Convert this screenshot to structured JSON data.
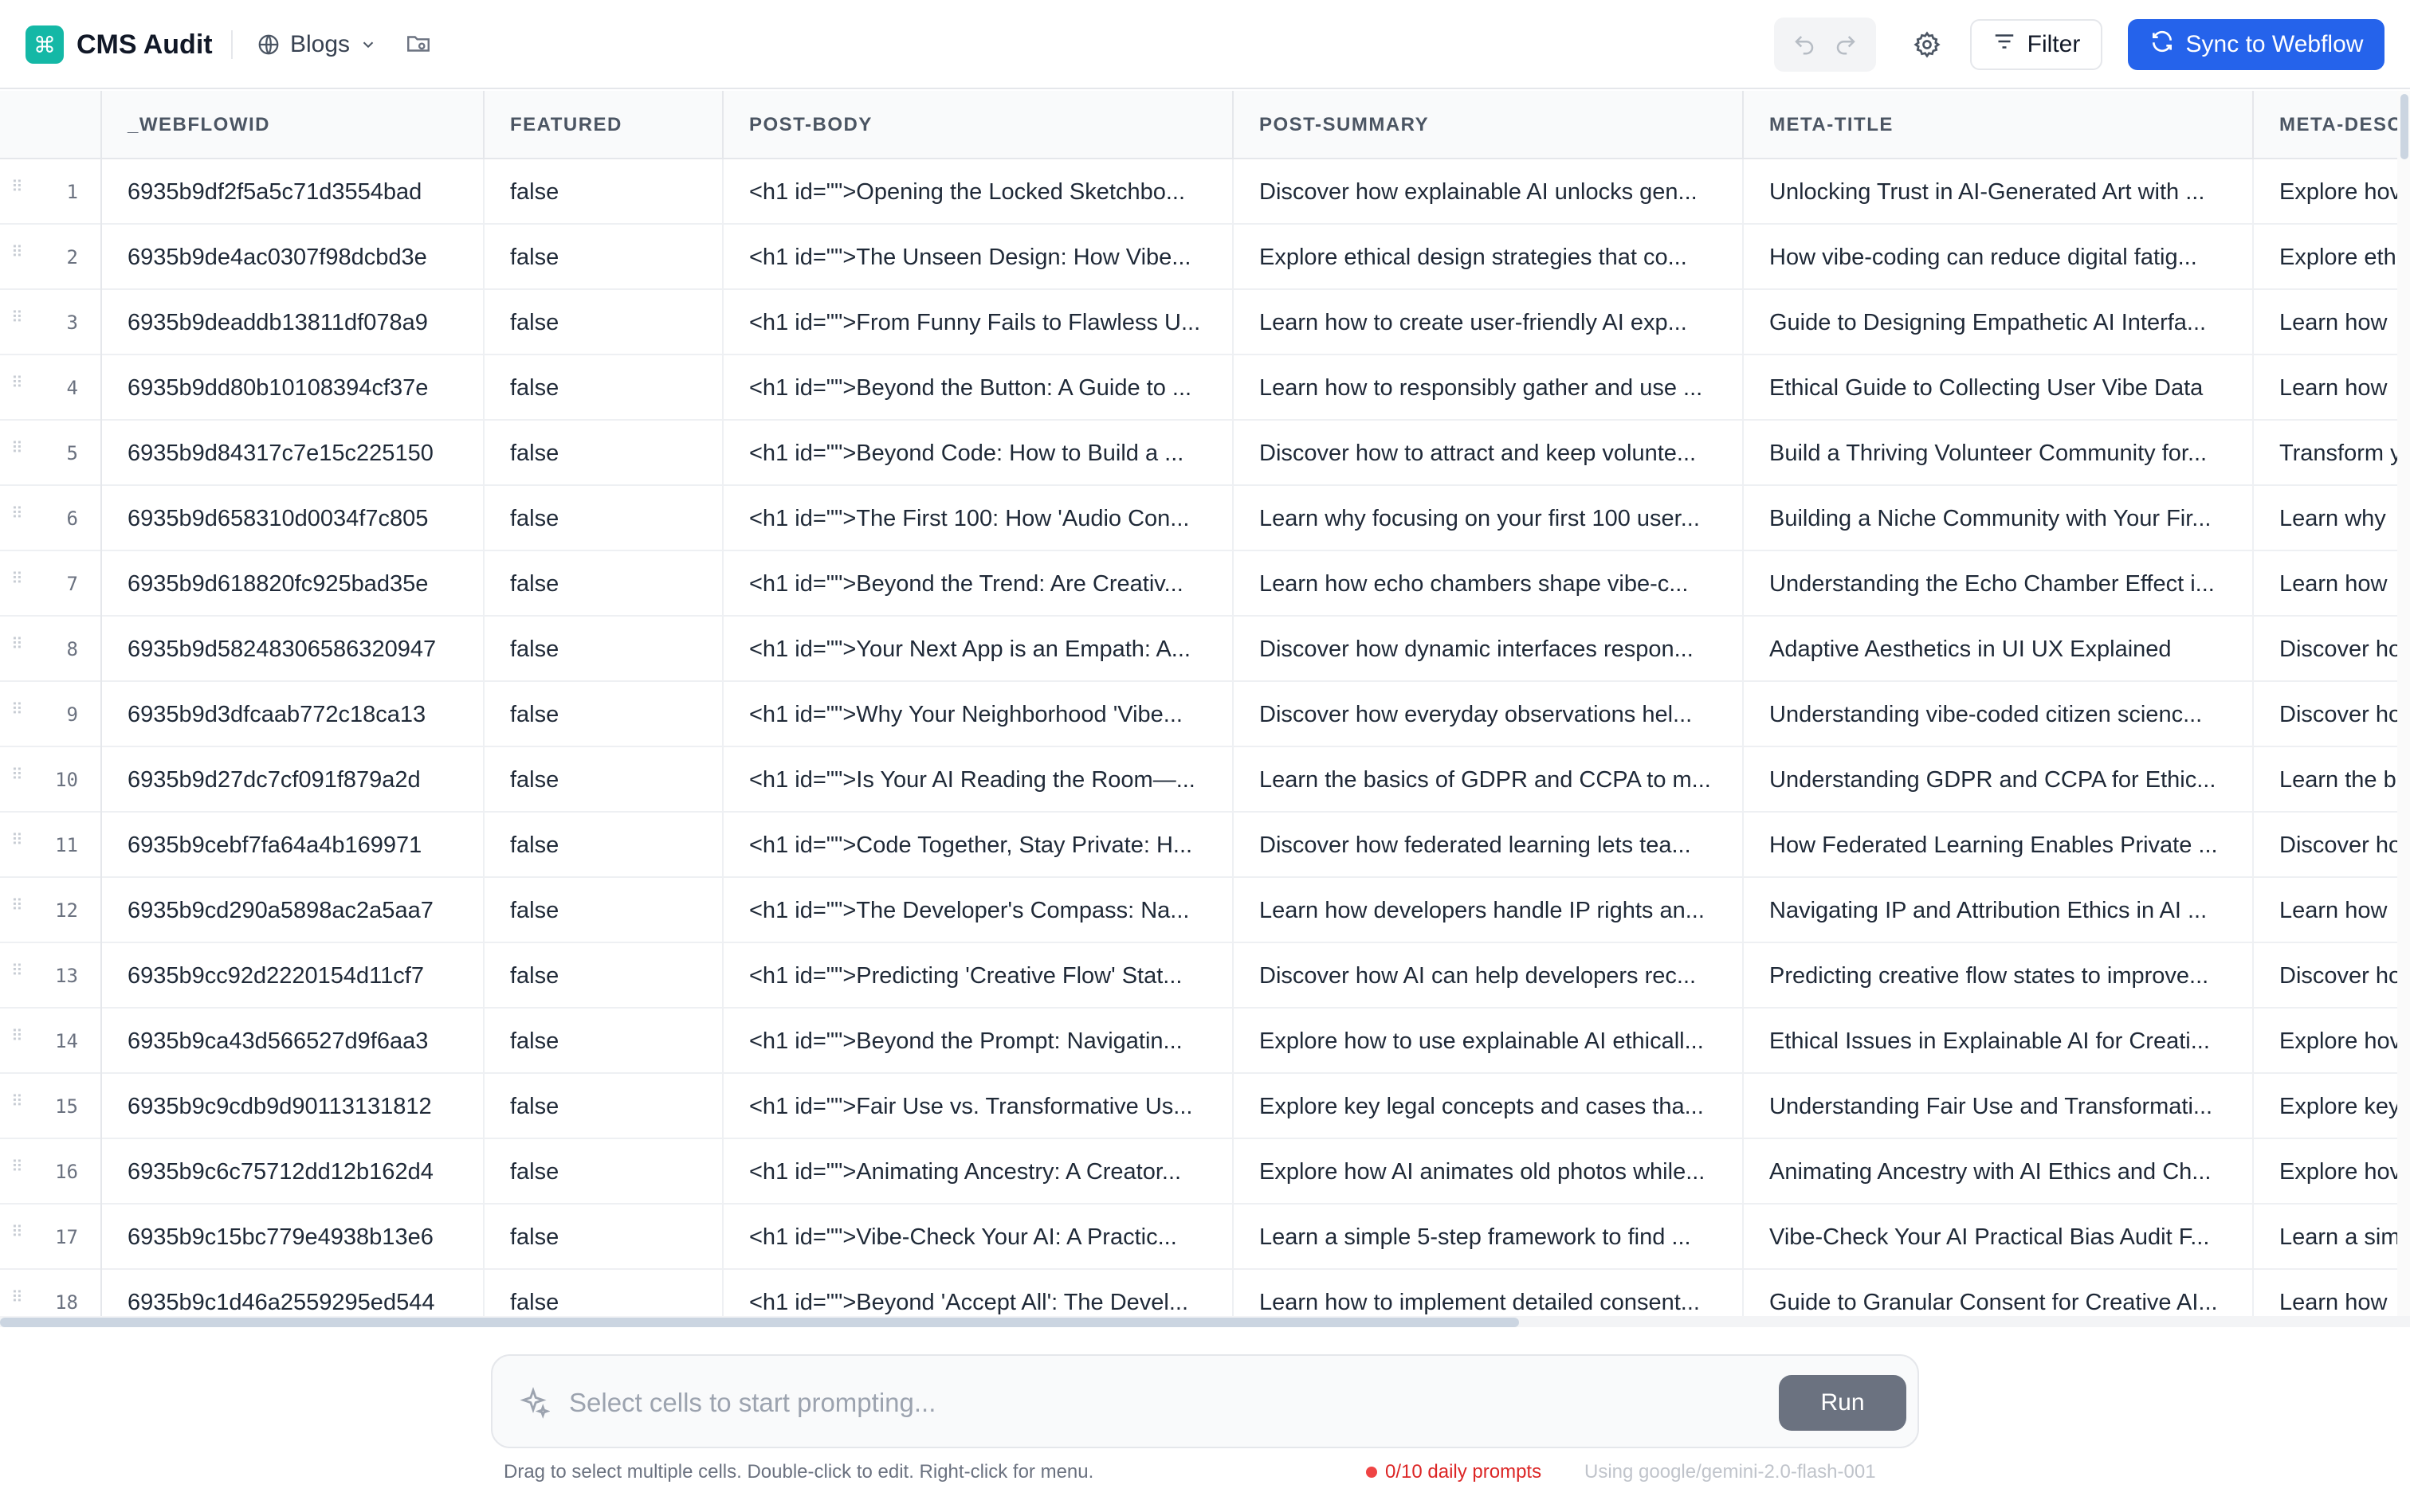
{
  "header": {
    "logo_glyph": "⌘",
    "app_title": "CMS Audit",
    "collection": "Blogs",
    "filter_label": "Filter",
    "sync_label": "Sync to Webflow"
  },
  "colors": {
    "brand": "#14b8a6",
    "primary": "#2563eb",
    "quota": "#dc2626"
  },
  "table": {
    "columns": [
      "_WEBFLOWID",
      "FEATURED",
      "POST-BODY",
      "POST-SUMMARY",
      "META-TITLE",
      "META-DESC"
    ],
    "rows": [
      {
        "n": "1",
        "id": "6935b9df2f5a5c71d3554bad",
        "featured": "false",
        "body": "<h1 id=\"\">Opening the Locked Sketchbo...",
        "summary": "Discover how explainable AI unlocks gen...",
        "title": "Unlocking Trust in AI-Generated Art with ...",
        "desc": "Explore hov"
      },
      {
        "n": "2",
        "id": "6935b9de4ac0307f98dcbd3e",
        "featured": "false",
        "body": "<h1 id=\"\">The Unseen Design: How Vibe...",
        "summary": "Explore ethical design strategies that co...",
        "title": "How vibe-coding can reduce digital fatig...",
        "desc": "Explore eth"
      },
      {
        "n": "3",
        "id": "6935b9deaddb13811df078a9",
        "featured": "false",
        "body": "<h1 id=\"\">From Funny Fails to Flawless U...",
        "summary": "Learn how to create user-friendly AI exp...",
        "title": "Guide to Designing Empathetic AI Interfa...",
        "desc": "Learn how"
      },
      {
        "n": "4",
        "id": "6935b9dd80b10108394cf37e",
        "featured": "false",
        "body": "<h1 id=\"\">Beyond the Button: A Guide to ...",
        "summary": "Learn how to responsibly gather and use ...",
        "title": "Ethical Guide to Collecting User Vibe Data",
        "desc": "Learn how"
      },
      {
        "n": "5",
        "id": "6935b9d84317c7e15c225150",
        "featured": "false",
        "body": "<h1 id=\"\">Beyond Code: How to Build a ...",
        "summary": "Discover how to attract and keep volunte...",
        "title": "Build a Thriving Volunteer Community for...",
        "desc": "Transform y"
      },
      {
        "n": "6",
        "id": "6935b9d658310d0034f7c805",
        "featured": "false",
        "body": "<h1 id=\"\">The First 100: How 'Audio Con...",
        "summary": "Learn why focusing on your first 100 user...",
        "title": "Building a Niche Community with Your Fir...",
        "desc": "Learn why"
      },
      {
        "n": "7",
        "id": "6935b9d618820fc925bad35e",
        "featured": "false",
        "body": "<h1 id=\"\">Beyond the Trend: Are Creativ...",
        "summary": "Learn how echo chambers shape vibe-c...",
        "title": "Understanding the Echo Chamber Effect i...",
        "desc": "Learn how"
      },
      {
        "n": "8",
        "id": "6935b9d58248306586320947",
        "featured": "false",
        "body": "<h1 id=\"\">Your Next App is an Empath: A...",
        "summary": "Discover how dynamic interfaces respon...",
        "title": "Adaptive Aesthetics in UI UX Explained",
        "desc": "Discover ho"
      },
      {
        "n": "9",
        "id": "6935b9d3dfcaab772c18ca13",
        "featured": "false",
        "body": "<h1 id=\"\">Why Your Neighborhood 'Vibe...",
        "summary": "Discover how everyday observations hel...",
        "title": "Understanding vibe-coded citizen scienc...",
        "desc": "Discover ho"
      },
      {
        "n": "10",
        "id": "6935b9d27dc7cf091f879a2d",
        "featured": "false",
        "body": "<h1 id=\"\">Is Your AI Reading the Room—...",
        "summary": "Learn the basics of GDPR and CCPA to m...",
        "title": "Understanding GDPR and CCPA for Ethic...",
        "desc": "Learn the b"
      },
      {
        "n": "11",
        "id": "6935b9cebf7fa64a4b169971",
        "featured": "false",
        "body": "<h1 id=\"\">Code Together, Stay Private: H...",
        "summary": "Discover how federated learning lets tea...",
        "title": "How Federated Learning Enables Private ...",
        "desc": "Discover ho"
      },
      {
        "n": "12",
        "id": "6935b9cd290a5898ac2a5aa7",
        "featured": "false",
        "body": "<h1 id=\"\">The Developer's Compass: Na...",
        "summary": "Learn how developers handle IP rights an...",
        "title": "Navigating IP and Attribution Ethics in AI ...",
        "desc": "Learn how"
      },
      {
        "n": "13",
        "id": "6935b9cc92d2220154d11cf7",
        "featured": "false",
        "body": "<h1 id=\"\">Predicting 'Creative Flow' Stat...",
        "summary": "Discover how AI can help developers rec...",
        "title": "Predicting creative flow states to improve...",
        "desc": "Discover ho"
      },
      {
        "n": "14",
        "id": "6935b9ca43d566527d9f6aa3",
        "featured": "false",
        "body": "<h1 id=\"\">Beyond the Prompt: Navigatin...",
        "summary": "Explore how to use explainable AI ethicall...",
        "title": "Ethical Issues in Explainable AI for Creati...",
        "desc": "Explore hov"
      },
      {
        "n": "15",
        "id": "6935b9c9cdb9d90113131812",
        "featured": "false",
        "body": "<h1 id=\"\">Fair Use vs. Transformative Us...",
        "summary": "Explore key legal concepts and cases tha...",
        "title": "Understanding Fair Use and Transformati...",
        "desc": "Explore key"
      },
      {
        "n": "16",
        "id": "6935b9c6c75712dd12b162d4",
        "featured": "false",
        "body": "<h1 id=\"\">Animating Ancestry: A Creator...",
        "summary": "Explore how AI animates old photos while...",
        "title": "Animating Ancestry with AI Ethics and Ch...",
        "desc": "Explore hov"
      },
      {
        "n": "17",
        "id": "6935b9c15bc779e4938b13e6",
        "featured": "false",
        "body": "<h1 id=\"\">Vibe-Check Your AI: A Practic...",
        "summary": "Learn a simple 5-step framework to find ...",
        "title": "Vibe-Check Your AI Practical Bias Audit F...",
        "desc": "Learn a sim"
      },
      {
        "n": "18",
        "id": "6935b9c1d46a2559295ed544",
        "featured": "false",
        "body": "<h1 id=\"\">Beyond 'Accept All': The Devel...",
        "summary": "Learn how to implement detailed consent...",
        "title": "Guide to Granular Consent for Creative AI...",
        "desc": "Learn how"
      }
    ]
  },
  "prompt": {
    "placeholder": "Select cells to start prompting...",
    "run_label": "Run",
    "hint": "Drag to select multiple cells. Double-click to edit. Right-click for menu.",
    "quota": "0/10 daily prompts",
    "model": "Using google/gemini-2.0-flash-001"
  }
}
